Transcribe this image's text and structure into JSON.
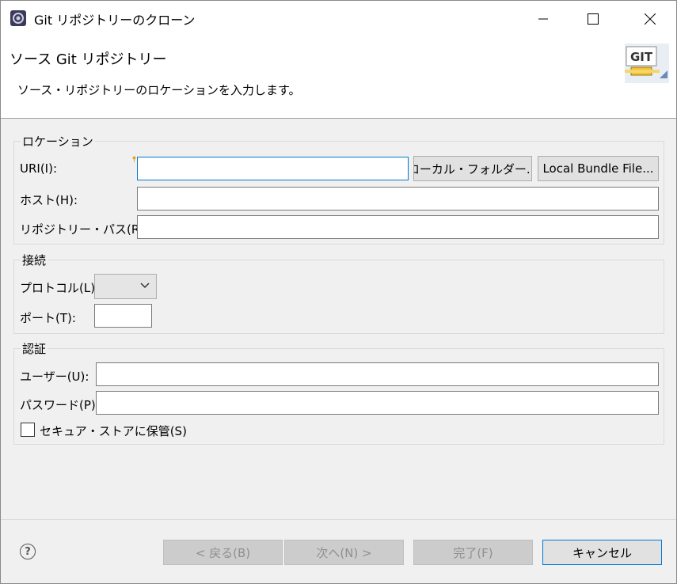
{
  "window": {
    "title": "Git リポジトリーのクローン",
    "minimize_glyph": "—",
    "maximize_glyph": "☐",
    "close_glyph": "✕"
  },
  "header": {
    "title": "ソース Git リポジトリー",
    "description": "ソース・リポジトリーのロケーションを入力します。",
    "banner_text": "GIT"
  },
  "location": {
    "group_label": "ロケーション",
    "uri_label": "URI(I):",
    "uri_value": "",
    "local_folder_button": "ローカル・フォルダー...",
    "local_bundle_button": "Local Bundle File...",
    "host_label": "ホスト(H):",
    "host_value": "",
    "repo_path_label": "リポジトリー・パス(R):",
    "repo_path_value": ""
  },
  "connection": {
    "group_label": "接続",
    "protocol_label": "プロトコル(L):",
    "protocol_value": "",
    "port_label": "ポート(T):",
    "port_value": ""
  },
  "auth": {
    "group_label": "認証",
    "user_label": "ユーザー(U):",
    "user_value": "",
    "password_label": "パスワード(P):",
    "password_value": "",
    "secure_store_label": "セキュア・ストアに保管(S)",
    "secure_store_checked": false
  },
  "footer": {
    "help_glyph": "?",
    "back_button": "< 戻る(B)",
    "next_button": "次へ(N) >",
    "finish_button": "完了(F)",
    "cancel_button": "キャンセル"
  },
  "colors": {
    "focus_border": "#0078d7",
    "disabled_text": "#8f8f8f",
    "window_bg": "#f0f0f0"
  }
}
